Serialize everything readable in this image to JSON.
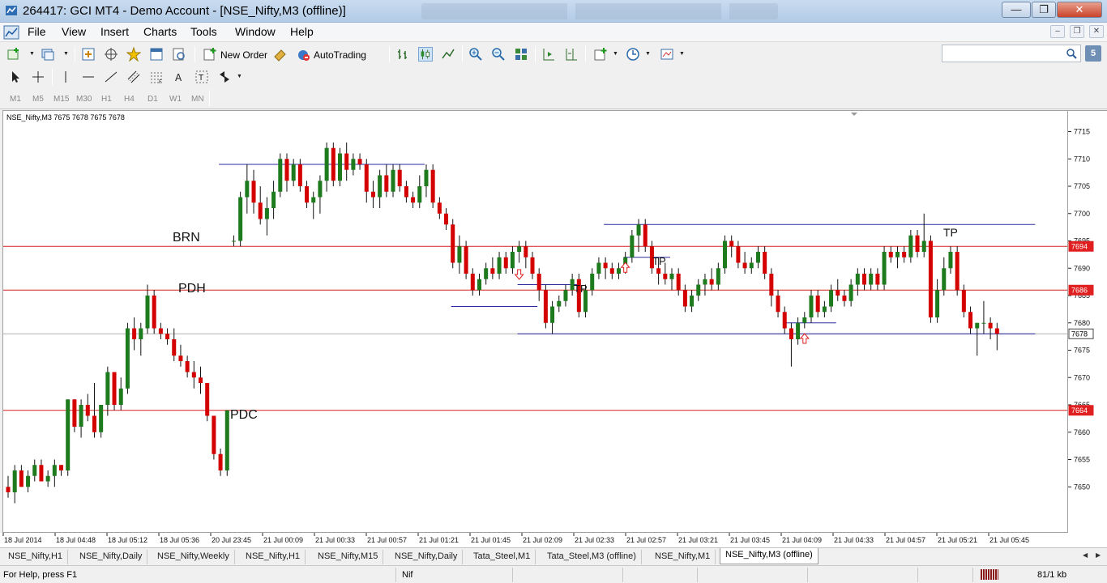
{
  "window": {
    "title": "264417: GCI MT4 - Demo Account - [NSE_Nifty,M3 (offline)]",
    "minimize": "—",
    "maximize": "❐",
    "close": "✕"
  },
  "menu": {
    "items": [
      "File",
      "View",
      "Insert",
      "Charts",
      "Tools",
      "Window",
      "Help"
    ]
  },
  "toolbar": {
    "new_order": "New Order",
    "autotrading": "AutoTrading"
  },
  "search": {
    "placeholder": ""
  },
  "help_button": "5",
  "periods": [
    "M1",
    "M5",
    "M15",
    "M30",
    "H1",
    "H4",
    "D1",
    "W1",
    "MN"
  ],
  "chart": {
    "info": "NSE_Nifty,M3  7675 7678 7675 7678",
    "price_ticks": [
      "7715",
      "7710",
      "7705",
      "7700",
      "7695",
      "7690",
      "7685",
      "7680",
      "7675",
      "7670",
      "7665",
      "7660",
      "7655",
      "7650"
    ],
    "time_ticks": [
      "18 Jul 2014",
      "18 Jul 04:48",
      "18 Jul 05:12",
      "18 Jul 05:36",
      "20 Jul 23:45",
      "21 Jul 00:09",
      "21 Jul 00:33",
      "21 Jul 00:57",
      "21 Jul 01:21",
      "21 Jul 01:45",
      "21 Jul 02:09",
      "21 Jul 02:33",
      "21 Jul 02:57",
      "21 Jul 03:21",
      "21 Jul 03:45",
      "21 Jul 04:09",
      "21 Jul 04:33",
      "21 Jul 04:57",
      "21 Jul 05:21",
      "21 Jul 05:45"
    ],
    "annotations": {
      "brn": "BRN",
      "pdh": "PDH",
      "pdc": "PDC",
      "tp1": "TP",
      "tp2": "TP",
      "tp3": "TP"
    },
    "level_labels": {
      "l7694": "7694",
      "l7686": "7686",
      "l7678": "7678",
      "l7664": "7664"
    },
    "colors": {
      "bull": "#1d7a1d",
      "bear": "#d40000",
      "level_line": "#d42020",
      "blue_line": "#2a2aa0"
    }
  },
  "chart_data": {
    "type": "candlestick",
    "symbol": "NSE_Nifty",
    "timeframe": "M3",
    "ylim": [
      7645,
      7717
    ],
    "horizontal_levels": [
      7694,
      7686,
      7678,
      7664
    ],
    "series": [
      {
        "o": 7650,
        "h": 7652,
        "l": 7648,
        "c": 7649
      },
      {
        "o": 7649,
        "h": 7654,
        "l": 7647,
        "c": 7653
      },
      {
        "o": 7653,
        "h": 7654,
        "l": 7650,
        "c": 7650
      },
      {
        "o": 7650,
        "h": 7653,
        "l": 7649,
        "c": 7652
      },
      {
        "o": 7652,
        "h": 7655,
        "l": 7651,
        "c": 7654
      },
      {
        "o": 7654,
        "h": 7655,
        "l": 7651,
        "c": 7651
      },
      {
        "o": 7651,
        "h": 7653,
        "l": 7650,
        "c": 7652
      },
      {
        "o": 7652,
        "h": 7655,
        "l": 7650,
        "c": 7654
      },
      {
        "o": 7654,
        "h": 7654,
        "l": 7652,
        "c": 7653
      },
      {
        "o": 7653,
        "h": 7666,
        "l": 7652,
        "c": 7666
      },
      {
        "o": 7666,
        "h": 7666,
        "l": 7660,
        "c": 7661
      },
      {
        "o": 7661,
        "h": 7666,
        "l": 7659,
        "c": 7665
      },
      {
        "o": 7665,
        "h": 7667,
        "l": 7662,
        "c": 7663
      },
      {
        "o": 7663,
        "h": 7669,
        "l": 7659,
        "c": 7660
      },
      {
        "o": 7660,
        "h": 7665,
        "l": 7659,
        "c": 7665
      },
      {
        "o": 7665,
        "h": 7672,
        "l": 7663,
        "c": 7671
      },
      {
        "o": 7671,
        "h": 7671,
        "l": 7664,
        "c": 7665
      },
      {
        "o": 7665,
        "h": 7670,
        "l": 7664,
        "c": 7668
      },
      {
        "o": 7668,
        "h": 7680,
        "l": 7667,
        "c": 7679
      },
      {
        "o": 7679,
        "h": 7681,
        "l": 7675,
        "c": 7677
      },
      {
        "o": 7677,
        "h": 7680,
        "l": 7674,
        "c": 7679
      },
      {
        "o": 7679,
        "h": 7687,
        "l": 7678,
        "c": 7685
      },
      {
        "o": 7685,
        "h": 7686,
        "l": 7678,
        "c": 7679
      },
      {
        "o": 7679,
        "h": 7680,
        "l": 7677,
        "c": 7678
      },
      {
        "o": 7678,
        "h": 7679,
        "l": 7676,
        "c": 7677
      },
      {
        "o": 7677,
        "h": 7679,
        "l": 7673,
        "c": 7674
      },
      {
        "o": 7674,
        "h": 7676,
        "l": 7672,
        "c": 7673
      },
      {
        "o": 7673,
        "h": 7674,
        "l": 7670,
        "c": 7671
      },
      {
        "o": 7671,
        "h": 7673,
        "l": 7668,
        "c": 7670
      },
      {
        "o": 7670,
        "h": 7672,
        "l": 7667,
        "c": 7669
      },
      {
        "o": 7669,
        "h": 7669,
        "l": 7662,
        "c": 7663
      },
      {
        "o": 7663,
        "h": 7663,
        "l": 7655,
        "c": 7656
      },
      {
        "o": 7656,
        "h": 7657,
        "l": 7652,
        "c": 7653
      },
      {
        "o": 7653,
        "h": 7664,
        "l": 7652,
        "c": 7664
      },
      {
        "o": 7695,
        "h": 7696,
        "l": 7694,
        "c": 7695
      },
      {
        "o": 7695,
        "h": 7704,
        "l": 7694,
        "c": 7703
      },
      {
        "o": 7703,
        "h": 7709,
        "l": 7700,
        "c": 7706
      },
      {
        "o": 7706,
        "h": 7708,
        "l": 7700,
        "c": 7702
      },
      {
        "o": 7702,
        "h": 7705,
        "l": 7698,
        "c": 7699
      },
      {
        "o": 7699,
        "h": 7703,
        "l": 7696,
        "c": 7701
      },
      {
        "o": 7701,
        "h": 7706,
        "l": 7699,
        "c": 7704
      },
      {
        "o": 7704,
        "h": 7711,
        "l": 7703,
        "c": 7710
      },
      {
        "o": 7710,
        "h": 7711,
        "l": 7704,
        "c": 7706
      },
      {
        "o": 7706,
        "h": 7710,
        "l": 7705,
        "c": 7709
      },
      {
        "o": 7709,
        "h": 7710,
        "l": 7704,
        "c": 7705
      },
      {
        "o": 7705,
        "h": 7706,
        "l": 7701,
        "c": 7702
      },
      {
        "o": 7702,
        "h": 7704,
        "l": 7699,
        "c": 7703
      },
      {
        "o": 7703,
        "h": 7707,
        "l": 7700,
        "c": 7706
      },
      {
        "o": 7706,
        "h": 7713,
        "l": 7704,
        "c": 7712
      },
      {
        "o": 7712,
        "h": 7713,
        "l": 7705,
        "c": 7706
      },
      {
        "o": 7706,
        "h": 7712,
        "l": 7705,
        "c": 7711
      },
      {
        "o": 7711,
        "h": 7713,
        "l": 7706,
        "c": 7708
      },
      {
        "o": 7708,
        "h": 7711,
        "l": 7707,
        "c": 7710
      },
      {
        "o": 7710,
        "h": 7711,
        "l": 7708,
        "c": 7709
      },
      {
        "o": 7709,
        "h": 7710,
        "l": 7702,
        "c": 7704
      },
      {
        "o": 7704,
        "h": 7706,
        "l": 7701,
        "c": 7703
      },
      {
        "o": 7703,
        "h": 7708,
        "l": 7701,
        "c": 7707
      },
      {
        "o": 7707,
        "h": 7709,
        "l": 7703,
        "c": 7704
      },
      {
        "o": 7704,
        "h": 7709,
        "l": 7703,
        "c": 7708
      },
      {
        "o": 7708,
        "h": 7709,
        "l": 7704,
        "c": 7705
      },
      {
        "o": 7705,
        "h": 7706,
        "l": 7702,
        "c": 7703
      },
      {
        "o": 7703,
        "h": 7704,
        "l": 7701,
        "c": 7702
      },
      {
        "o": 7702,
        "h": 7707,
        "l": 7701,
        "c": 7705
      },
      {
        "o": 7705,
        "h": 7709,
        "l": 7703,
        "c": 7708
      },
      {
        "o": 7708,
        "h": 7709,
        "l": 7701,
        "c": 7702
      },
      {
        "o": 7702,
        "h": 7703,
        "l": 7699,
        "c": 7700
      },
      {
        "o": 7700,
        "h": 7701,
        "l": 7697,
        "c": 7698
      },
      {
        "o": 7698,
        "h": 7699,
        "l": 7690,
        "c": 7691
      },
      {
        "o": 7691,
        "h": 7696,
        "l": 7689,
        "c": 7694
      },
      {
        "o": 7694,
        "h": 7695,
        "l": 7688,
        "c": 7689
      },
      {
        "o": 7689,
        "h": 7690,
        "l": 7685,
        "c": 7686
      },
      {
        "o": 7686,
        "h": 7689,
        "l": 7685,
        "c": 7688
      },
      {
        "o": 7688,
        "h": 7691,
        "l": 7687,
        "c": 7690
      },
      {
        "o": 7690,
        "h": 7692,
        "l": 7688,
        "c": 7689
      },
      {
        "o": 7689,
        "h": 7693,
        "l": 7688,
        "c": 7692
      },
      {
        "o": 7692,
        "h": 7693,
        "l": 7689,
        "c": 7690
      },
      {
        "o": 7690,
        "h": 7694,
        "l": 7689,
        "c": 7693
      },
      {
        "o": 7693,
        "h": 7695,
        "l": 7691,
        "c": 7694
      },
      {
        "o": 7694,
        "h": 7695,
        "l": 7690,
        "c": 7692
      },
      {
        "o": 7692,
        "h": 7693,
        "l": 7688,
        "c": 7689
      },
      {
        "o": 7689,
        "h": 7690,
        "l": 7684,
        "c": 7686
      },
      {
        "o": 7686,
        "h": 7687,
        "l": 7679,
        "c": 7680
      },
      {
        "o": 7680,
        "h": 7684,
        "l": 7678,
        "c": 7683
      },
      {
        "o": 7683,
        "h": 7685,
        "l": 7682,
        "c": 7684
      },
      {
        "o": 7684,
        "h": 7687,
        "l": 7683,
        "c": 7686
      },
      {
        "o": 7686,
        "h": 7689,
        "l": 7685,
        "c": 7688
      },
      {
        "o": 7688,
        "h": 7689,
        "l": 7681,
        "c": 7682
      },
      {
        "o": 7682,
        "h": 7687,
        "l": 7681,
        "c": 7686
      },
      {
        "o": 7686,
        "h": 7690,
        "l": 7685,
        "c": 7689
      },
      {
        "o": 7689,
        "h": 7692,
        "l": 7688,
        "c": 7691
      },
      {
        "o": 7691,
        "h": 7692,
        "l": 7688,
        "c": 7690
      },
      {
        "o": 7690,
        "h": 7691,
        "l": 7688,
        "c": 7689
      },
      {
        "o": 7689,
        "h": 7691,
        "l": 7688,
        "c": 7690
      },
      {
        "o": 7690,
        "h": 7693,
        "l": 7689,
        "c": 7692
      },
      {
        "o": 7692,
        "h": 7697,
        "l": 7691,
        "c": 7696
      },
      {
        "o": 7696,
        "h": 7699,
        "l": 7693,
        "c": 7698
      },
      {
        "o": 7698,
        "h": 7699,
        "l": 7693,
        "c": 7694
      },
      {
        "o": 7694,
        "h": 7695,
        "l": 7689,
        "c": 7690
      },
      {
        "o": 7690,
        "h": 7692,
        "l": 7687,
        "c": 7689
      },
      {
        "o": 7689,
        "h": 7691,
        "l": 7687,
        "c": 7688
      },
      {
        "o": 7688,
        "h": 7690,
        "l": 7686,
        "c": 7689
      },
      {
        "o": 7689,
        "h": 7690,
        "l": 7685,
        "c": 7686
      },
      {
        "o": 7686,
        "h": 7687,
        "l": 7682,
        "c": 7683
      },
      {
        "o": 7683,
        "h": 7686,
        "l": 7682,
        "c": 7685
      },
      {
        "o": 7685,
        "h": 7688,
        "l": 7684,
        "c": 7687
      },
      {
        "o": 7687,
        "h": 7689,
        "l": 7685,
        "c": 7688
      },
      {
        "o": 7688,
        "h": 7690,
        "l": 7686,
        "c": 7687
      },
      {
        "o": 7687,
        "h": 7691,
        "l": 7686,
        "c": 7690
      },
      {
        "o": 7690,
        "h": 7696,
        "l": 7689,
        "c": 7695
      },
      {
        "o": 7695,
        "h": 7696,
        "l": 7692,
        "c": 7694
      },
      {
        "o": 7694,
        "h": 7695,
        "l": 7690,
        "c": 7691
      },
      {
        "o": 7691,
        "h": 7693,
        "l": 7689,
        "c": 7690
      },
      {
        "o": 7690,
        "h": 7692,
        "l": 7689,
        "c": 7691
      },
      {
        "o": 7691,
        "h": 7694,
        "l": 7690,
        "c": 7693
      },
      {
        "o": 7693,
        "h": 7694,
        "l": 7688,
        "c": 7689
      },
      {
        "o": 7689,
        "h": 7690,
        "l": 7683,
        "c": 7685
      },
      {
        "o": 7685,
        "h": 7686,
        "l": 7681,
        "c": 7682
      },
      {
        "o": 7682,
        "h": 7683,
        "l": 7678,
        "c": 7679
      },
      {
        "o": 7679,
        "h": 7680,
        "l": 7672,
        "c": 7677
      },
      {
        "o": 7677,
        "h": 7681,
        "l": 7676,
        "c": 7680
      },
      {
        "o": 7680,
        "h": 7682,
        "l": 7679,
        "c": 7681
      },
      {
        "o": 7681,
        "h": 7686,
        "l": 7680,
        "c": 7685
      },
      {
        "o": 7685,
        "h": 7686,
        "l": 7681,
        "c": 7682
      },
      {
        "o": 7682,
        "h": 7684,
        "l": 7681,
        "c": 7683
      },
      {
        "o": 7683,
        "h": 7687,
        "l": 7682,
        "c": 7686
      },
      {
        "o": 7686,
        "h": 7688,
        "l": 7684,
        "c": 7685
      },
      {
        "o": 7685,
        "h": 7686,
        "l": 7683,
        "c": 7684
      },
      {
        "o": 7684,
        "h": 7688,
        "l": 7683,
        "c": 7687
      },
      {
        "o": 7687,
        "h": 7690,
        "l": 7685,
        "c": 7689
      },
      {
        "o": 7689,
        "h": 7690,
        "l": 7686,
        "c": 7687
      },
      {
        "o": 7687,
        "h": 7690,
        "l": 7686,
        "c": 7689
      },
      {
        "o": 7689,
        "h": 7690,
        "l": 7686,
        "c": 7687
      },
      {
        "o": 7687,
        "h": 7694,
        "l": 7686,
        "c": 7693
      },
      {
        "o": 7693,
        "h": 7694,
        "l": 7691,
        "c": 7692
      },
      {
        "o": 7692,
        "h": 7694,
        "l": 7690,
        "c": 7693
      },
      {
        "o": 7693,
        "h": 7694,
        "l": 7691,
        "c": 7692
      },
      {
        "o": 7692,
        "h": 7697,
        "l": 7691,
        "c": 7696
      },
      {
        "o": 7696,
        "h": 7697,
        "l": 7692,
        "c": 7693
      },
      {
        "o": 7693,
        "h": 7700,
        "l": 7692,
        "c": 7695
      },
      {
        "o": 7695,
        "h": 7696,
        "l": 7680,
        "c": 7681
      },
      {
        "o": 7681,
        "h": 7688,
        "l": 7680,
        "c": 7686
      },
      {
        "o": 7686,
        "h": 7692,
        "l": 7685,
        "c": 7690
      },
      {
        "o": 7690,
        "h": 7694,
        "l": 7689,
        "c": 7693
      },
      {
        "o": 7693,
        "h": 7694,
        "l": 7685,
        "c": 7686
      },
      {
        "o": 7686,
        "h": 7687,
        "l": 7681,
        "c": 7682
      },
      {
        "o": 7682,
        "h": 7683,
        "l": 7678,
        "c": 7679
      },
      {
        "o": 7679,
        "h": 7680,
        "l": 7674,
        "c": 7680
      },
      {
        "o": 7680,
        "h": 7684,
        "l": 7678,
        "c": 7680
      },
      {
        "o": 7680,
        "h": 7681,
        "l": 7677,
        "c": 7679
      },
      {
        "o": 7679,
        "h": 7680,
        "l": 7675,
        "c": 7678
      }
    ]
  },
  "tabs": {
    "items": [
      "NSE_Nifty,H1",
      "NSE_Nifty,Daily",
      "NSE_Nifty,Weekly",
      "NSE_Nifty,H1",
      "NSE_Nifty,M15",
      "NSE_Nifty,Daily",
      "Tata_Steel,M1",
      "Tata_Steel,M3 (offline)",
      "NSE_Nifty,M1",
      "NSE_Nifty,M3 (offline)"
    ],
    "active_index": 9
  },
  "status": {
    "help": "For Help, press F1",
    "symbol": "Nif",
    "traffic": "81/1 kb"
  }
}
